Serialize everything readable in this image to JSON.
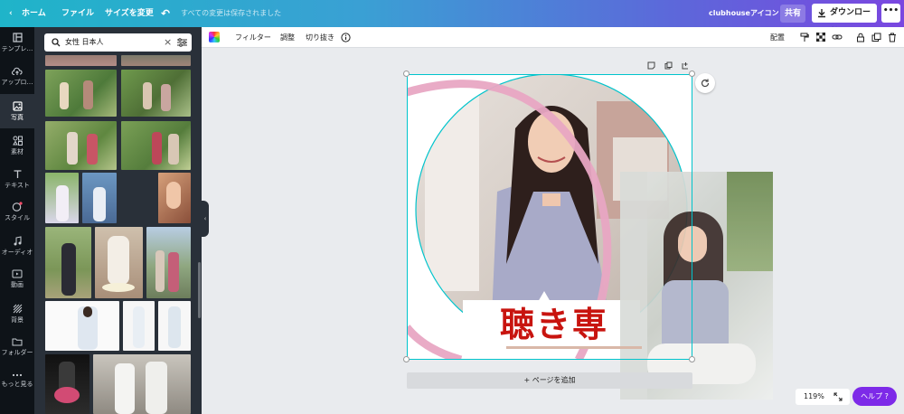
{
  "topbar": {
    "home": "ホーム",
    "file": "ファイル",
    "resize": "サイズを変更",
    "save_status": "すべての変更は保存されました",
    "doc_title": "clubhouseアイコン",
    "share": "共有",
    "download": "ダウンロード",
    "more": "•••"
  },
  "sidebar": {
    "items": [
      {
        "label": "テンプレ…",
        "icon": "template-icon"
      },
      {
        "label": "アップロ…",
        "icon": "upload-icon"
      },
      {
        "label": "写真",
        "icon": "photo-icon"
      },
      {
        "label": "素材",
        "icon": "elements-icon"
      },
      {
        "label": "テキスト",
        "icon": "text-icon"
      },
      {
        "label": "スタイル",
        "icon": "style-icon"
      },
      {
        "label": "オーディオ",
        "icon": "audio-icon"
      },
      {
        "label": "動画",
        "icon": "video-icon"
      },
      {
        "label": "背景",
        "icon": "background-icon"
      },
      {
        "label": "フォルダー",
        "icon": "folder-icon"
      },
      {
        "label": "もっと見る",
        "icon": "more-icon"
      }
    ],
    "active": "写真"
  },
  "panel": {
    "search_value": "女性 日本人"
  },
  "toolbar": {
    "filter": "フィルター",
    "adjust": "調整",
    "crop": "切り抜き",
    "arrange": "配置"
  },
  "canvas": {
    "caption": "聴き専",
    "add_page": "+ ページを追加"
  },
  "footer": {
    "zoom": "119%",
    "help": "ヘルプ ?"
  },
  "colors": {
    "accent": "#7d2ae8",
    "selection": "#00c4cc",
    "caption_red": "#c8140f",
    "ring_pink": "#e8a7c3"
  }
}
